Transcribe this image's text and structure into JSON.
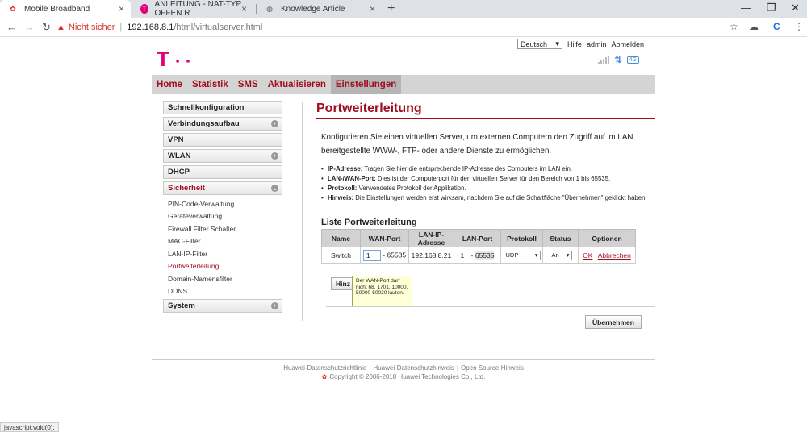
{
  "browser": {
    "tabs": [
      {
        "title": "Mobile Broadband",
        "active": true
      },
      {
        "title": "ANLEITUNG - NAT-TYP OFFEN R",
        "active": false
      },
      {
        "title": "Knowledge Article",
        "active": false
      }
    ],
    "url_security": "Nicht sicher",
    "url_host": "192.168.8.1",
    "url_path": "/html/virtualserver.html"
  },
  "header": {
    "language": "Deutsch",
    "help": "Hilfe",
    "user": "admin",
    "logout": "Abmelden",
    "network_type": "4G"
  },
  "mainnav": [
    "Home",
    "Statistik",
    "SMS",
    "Aktualisieren",
    "Einstellungen"
  ],
  "sidebar": {
    "sections": [
      {
        "label": "Schnellkonfiguration"
      },
      {
        "label": "Verbindungsaufbau",
        "expandable": true
      },
      {
        "label": "VPN"
      },
      {
        "label": "WLAN",
        "expandable": true
      },
      {
        "label": "DHCP"
      },
      {
        "label": "Sicherheit",
        "expandable": true,
        "open": true
      }
    ],
    "subitems": [
      "PIN-Code-Verwaltung",
      "Geräteverwaltung",
      "Firewall Filter Schalter",
      "MAC-Filter",
      "LAN-IP-Filter",
      "Portweiterleitung",
      "Domain-Namensfilter",
      "DDNS"
    ],
    "selected_subitem": "Portweiterleitung",
    "last_section": "System"
  },
  "content": {
    "title": "Portweiterleitung",
    "intro": "Konfigurieren Sie einen virtuellen Server, um externen Computern den Zugriff auf im LAN bereitgestellte WWW-, FTP- oder andere Dienste zu ermöglichen.",
    "bullets": [
      {
        "term": "IP-Adresse:",
        "text": " Tragen Sie hier die entsprechende IP-Adresse des Computers im LAN ein."
      },
      {
        "term": "LAN-/WAN-Port:",
        "text": " Dies ist der Computerport für den virtuellen Server für den Bereich von 1 bis 65535."
      },
      {
        "term": "Protokoll:",
        "text": " Verwendetes Protokoll der Applikation."
      },
      {
        "term": "Hinweis:",
        "text": " Die Einstellungen werden erst wirksam, nachdem Sie auf die Schaltfläche \"Übernehmen\" geklickt haben."
      }
    ],
    "list_title": "Liste Portweiterleitung",
    "columns": [
      "Name",
      "WAN-Port",
      "LAN-IP-Adresse",
      "LAN-Port",
      "Protokoll",
      "Status",
      "Optionen"
    ],
    "row": {
      "name": "Switch",
      "wan_start": "1",
      "wan_end": "- 65535",
      "ip": "192.168.8.21",
      "lan_start": "1",
      "lan_end": "65535",
      "protocol": "UDP",
      "status": "An",
      "ok": "OK",
      "cancel": "Abbrechen"
    },
    "add_button": "Hinz",
    "tooltip": "Der WAN-Port darf nicht 68, 1701, 10000, 50000-50020 lauten.",
    "apply_button": "Übernehmen"
  },
  "footer": {
    "links": [
      "Huawei-Datenschutzrichtlinie",
      "Huawei-Datenschutzhinweis",
      "Open Source-Hinweis"
    ],
    "copyright": "Copyright © 2006-2018 Huawei Technologies Co., Ltd."
  },
  "statusbar": "javascript:void(0);",
  "colors": {
    "brand": "#e20074",
    "accent": "#a00d1e"
  }
}
